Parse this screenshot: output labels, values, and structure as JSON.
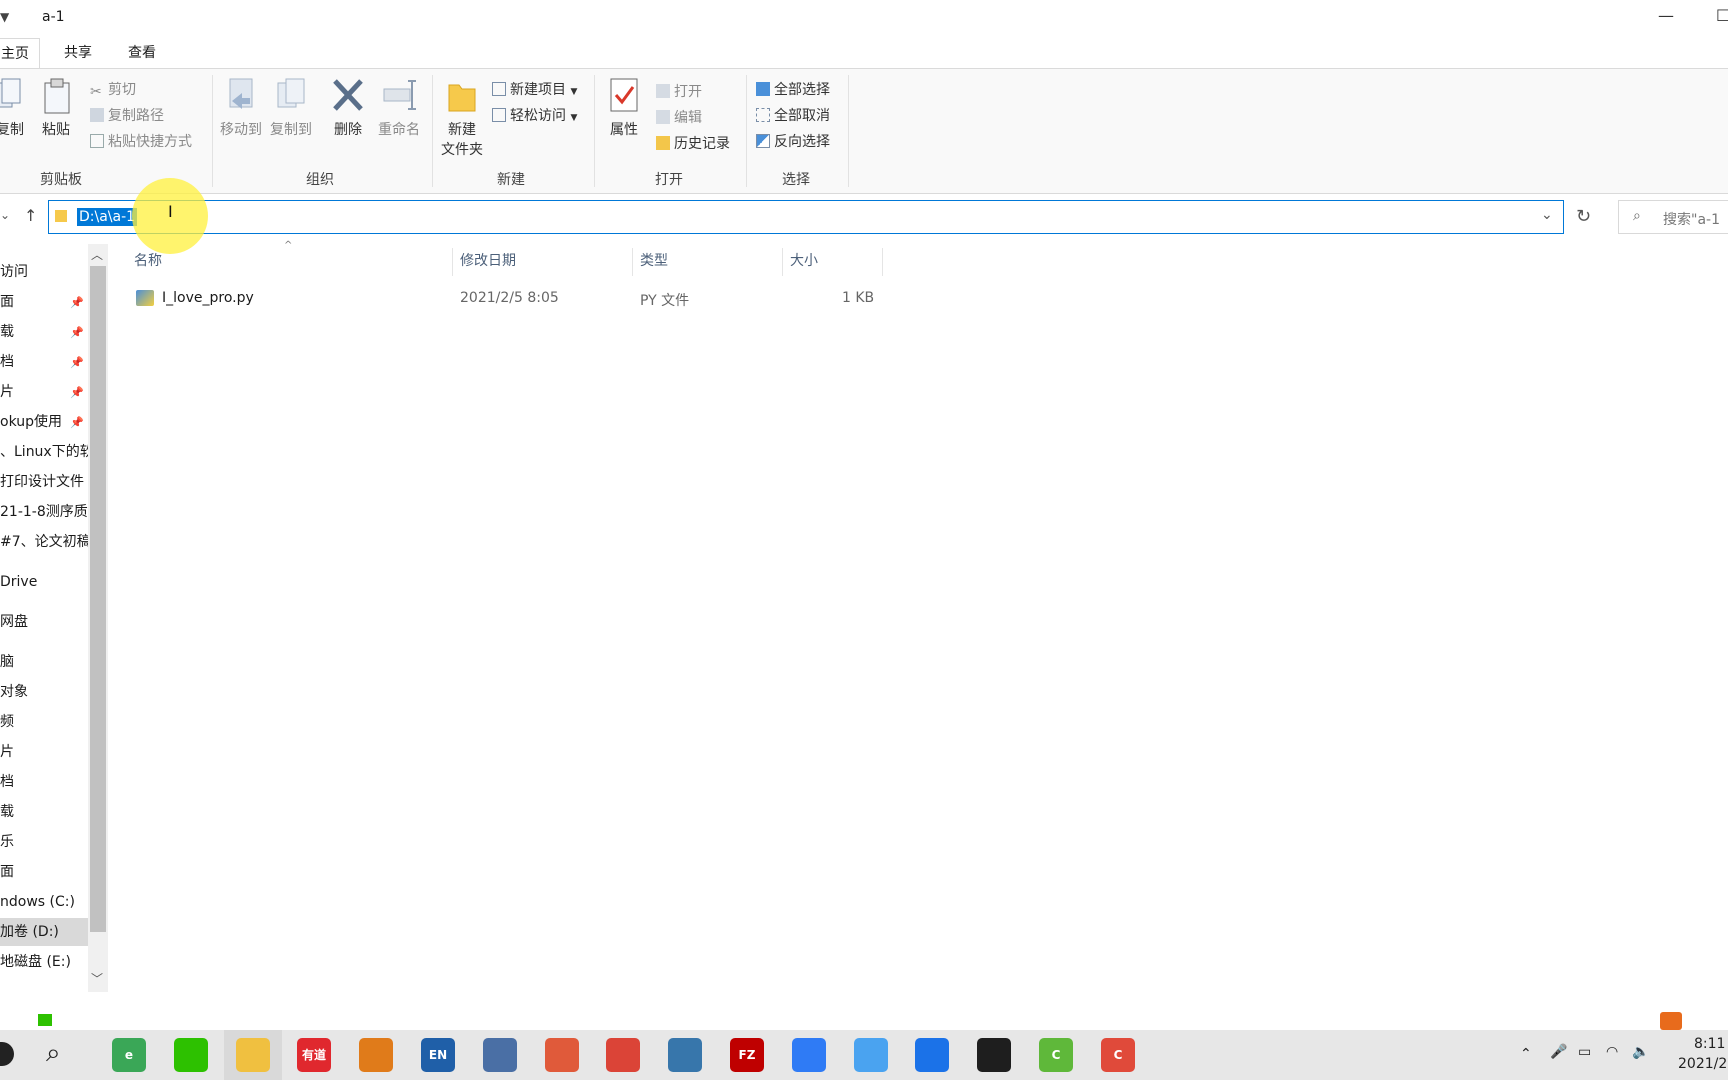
{
  "window": {
    "title": "a-1"
  },
  "tabs": [
    {
      "label": "主页",
      "active": true
    },
    {
      "label": "共享",
      "active": false
    },
    {
      "label": "查看",
      "active": false
    }
  ],
  "ribbon": {
    "clipboard": {
      "group_label": "剪贴板",
      "copy": "复制",
      "paste": "粘贴",
      "cut": "剪切",
      "copy_path": "复制路径",
      "paste_shortcut": "粘贴快捷方式"
    },
    "organize": {
      "group_label": "组织",
      "move_to": "移动到",
      "copy_to": "复制到",
      "delete": "删除",
      "rename": "重命名"
    },
    "new": {
      "group_label": "新建",
      "new_folder_line1": "新建",
      "new_folder_line2": "文件夹",
      "new_item": "新建项目",
      "easy_access": "轻松访问"
    },
    "open": {
      "group_label": "打开",
      "properties": "属性",
      "open": "打开",
      "edit": "编辑",
      "history": "历史记录"
    },
    "select": {
      "group_label": "选择",
      "select_all": "全部选择",
      "select_none": "全部取消",
      "invert": "反向选择"
    }
  },
  "address": {
    "path": "D:\\a\\a-1",
    "search_placeholder": "搜索\"a-1"
  },
  "nav": {
    "items": [
      {
        "label": "访问",
        "pinned": false
      },
      {
        "label": "面",
        "pinned": true
      },
      {
        "label": "载",
        "pinned": true
      },
      {
        "label": "档",
        "pinned": true
      },
      {
        "label": "片",
        "pinned": true
      },
      {
        "label": "okup使用",
        "pinned": true
      },
      {
        "label": "、Linux下的软",
        "pinned": false
      },
      {
        "label": "打印设计文件",
        "pinned": false
      },
      {
        "label": "21-1-8测序质",
        "pinned": false
      },
      {
        "label": "#7、论文初稿",
        "pinned": false
      },
      {
        "label": "Drive",
        "pinned": false
      },
      {
        "label": "网盘",
        "pinned": false
      },
      {
        "label": "脑",
        "pinned": false
      },
      {
        "label": "对象",
        "pinned": false
      },
      {
        "label": "频",
        "pinned": false
      },
      {
        "label": "片",
        "pinned": false
      },
      {
        "label": "档",
        "pinned": false
      },
      {
        "label": "载",
        "pinned": false
      },
      {
        "label": "乐",
        "pinned": false
      },
      {
        "label": "面",
        "pinned": false
      },
      {
        "label": "ndows (C:)",
        "pinned": false
      },
      {
        "label": "加卷 (D:)",
        "pinned": false,
        "selected": true
      },
      {
        "label": "地磁盘 (E:)",
        "pinned": false
      }
    ]
  },
  "columns": {
    "name": "名称",
    "date": "修改日期",
    "type": "类型",
    "size": "大小"
  },
  "files": [
    {
      "name": "I_love_pro.py",
      "date": "2021/2/5 8:05",
      "type": "PY 文件",
      "size": "1 KB"
    }
  ],
  "taskbar": {
    "apps": [
      {
        "icon": "ie-icon",
        "label": "e",
        "color": "#3aa757"
      },
      {
        "icon": "wechat-icon",
        "label": "",
        "color": "#2dc100"
      },
      {
        "icon": "explorer-icon",
        "label": "",
        "color": "#f0c040"
      },
      {
        "icon": "youdao-icon",
        "label": "有道",
        "color": "#e0282e"
      },
      {
        "icon": "search-tool-icon",
        "label": "",
        "color": "#e07b1a"
      },
      {
        "icon": "en-icon",
        "label": "EN",
        "color": "#1f5fa8"
      },
      {
        "icon": "network-icon",
        "label": "",
        "color": "#4a6fa5"
      },
      {
        "icon": "snail-icon",
        "label": "",
        "color": "#e05a3a"
      },
      {
        "icon": "chrome-icon",
        "label": "",
        "color": "#db4437"
      },
      {
        "icon": "python-icon",
        "label": "",
        "color": "#3776ab"
      },
      {
        "icon": "filezilla-icon",
        "label": "FZ",
        "color": "#bf0000"
      },
      {
        "icon": "feishu-icon",
        "label": "",
        "color": "#2f7bf5"
      },
      {
        "icon": "baidunetdisk-icon",
        "label": "",
        "color": "#4aa3f0"
      },
      {
        "icon": "tencent-meeting-icon",
        "label": "",
        "color": "#1b72e8"
      },
      {
        "icon": "terminal-icon",
        "label": "",
        "color": "#1e1e1e"
      },
      {
        "icon": "camtasia-green-icon",
        "label": "C",
        "color": "#5fb83a"
      },
      {
        "icon": "camtasia-red-icon",
        "label": "C",
        "color": "#e04a3a"
      }
    ],
    "clock_time": "8:11",
    "clock_date": "2021/2"
  },
  "colors": {
    "accent": "#0078d7",
    "selection": "#d9d9d9"
  }
}
